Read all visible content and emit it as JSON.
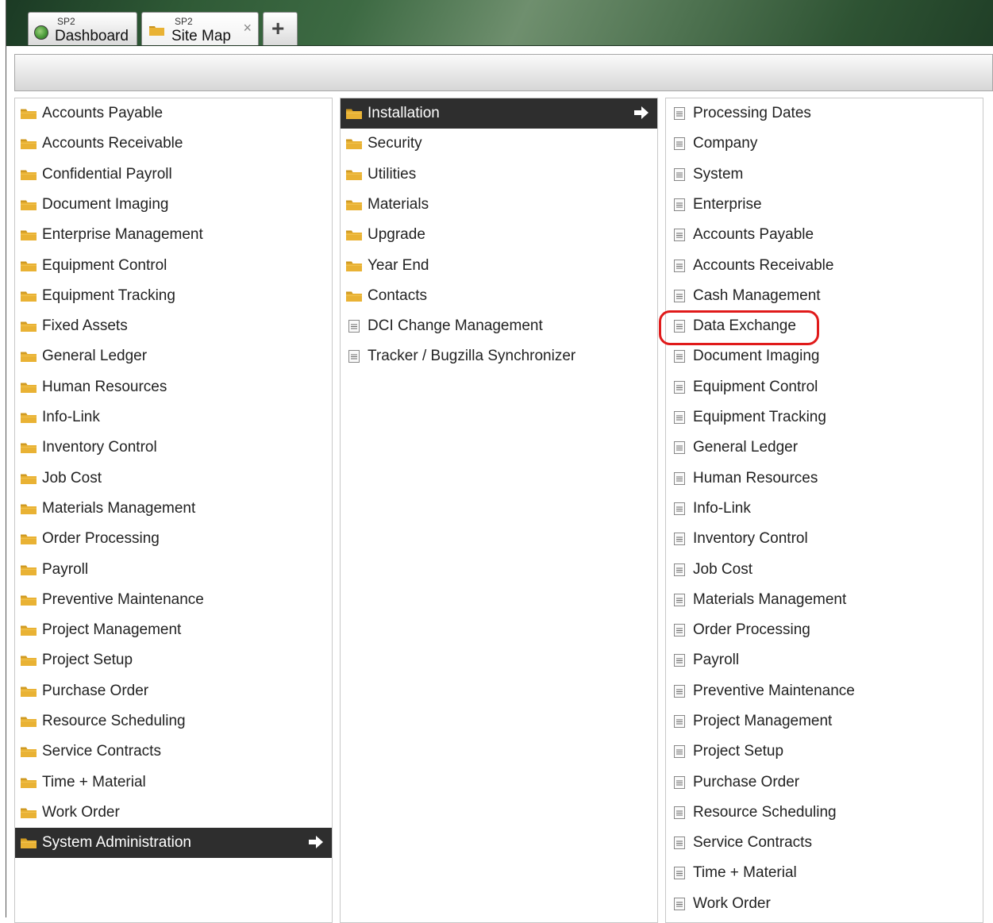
{
  "tabs": [
    {
      "subtitle": "SP2",
      "label": "Dashboard"
    },
    {
      "subtitle": "SP2",
      "label": "Site Map",
      "close": "×"
    }
  ],
  "add_tab_label": "+",
  "columns": {
    "modules": {
      "items": [
        "Accounts Payable",
        "Accounts Receivable",
        "Confidential Payroll",
        "Document Imaging",
        "Enterprise Management",
        "Equipment Control",
        "Equipment Tracking",
        "Fixed Assets",
        "General Ledger",
        "Human Resources",
        "Info-Link",
        "Inventory Control",
        "Job Cost",
        "Materials Management",
        "Order Processing",
        "Payroll",
        "Preventive Maintenance",
        "Project Management",
        "Project Setup",
        "Purchase Order",
        "Resource Scheduling",
        "Service Contracts",
        "Time + Material",
        "Work Order",
        "System Administration"
      ],
      "selected": "System Administration"
    },
    "system_admin": {
      "folders": [
        "Installation",
        "Security",
        "Utilities",
        "Materials",
        "Upgrade",
        "Year End",
        "Contacts"
      ],
      "pages": [
        "DCI Change Management",
        "Tracker / Bugzilla Synchronizer"
      ],
      "selected": "Installation"
    },
    "installation": {
      "pages": [
        "Processing Dates",
        "Company",
        "System",
        "Enterprise",
        "Accounts Payable",
        "Accounts Receivable",
        "Cash Management",
        "Data Exchange",
        "Document Imaging",
        "Equipment Control",
        "Equipment Tracking",
        "General Ledger",
        "Human Resources",
        "Info-Link",
        "Inventory Control",
        "Job Cost",
        "Materials Management",
        "Order Processing",
        "Payroll",
        "Preventive Maintenance",
        "Project Management",
        "Project Setup",
        "Purchase Order",
        "Resource Scheduling",
        "Service Contracts",
        "Time + Material",
        "Work Order"
      ],
      "highlighted": "Data Exchange"
    }
  },
  "colors": {
    "selected_bg": "#2e2e2e",
    "folder": "#e9b234",
    "highlight": "#e01a1a"
  }
}
